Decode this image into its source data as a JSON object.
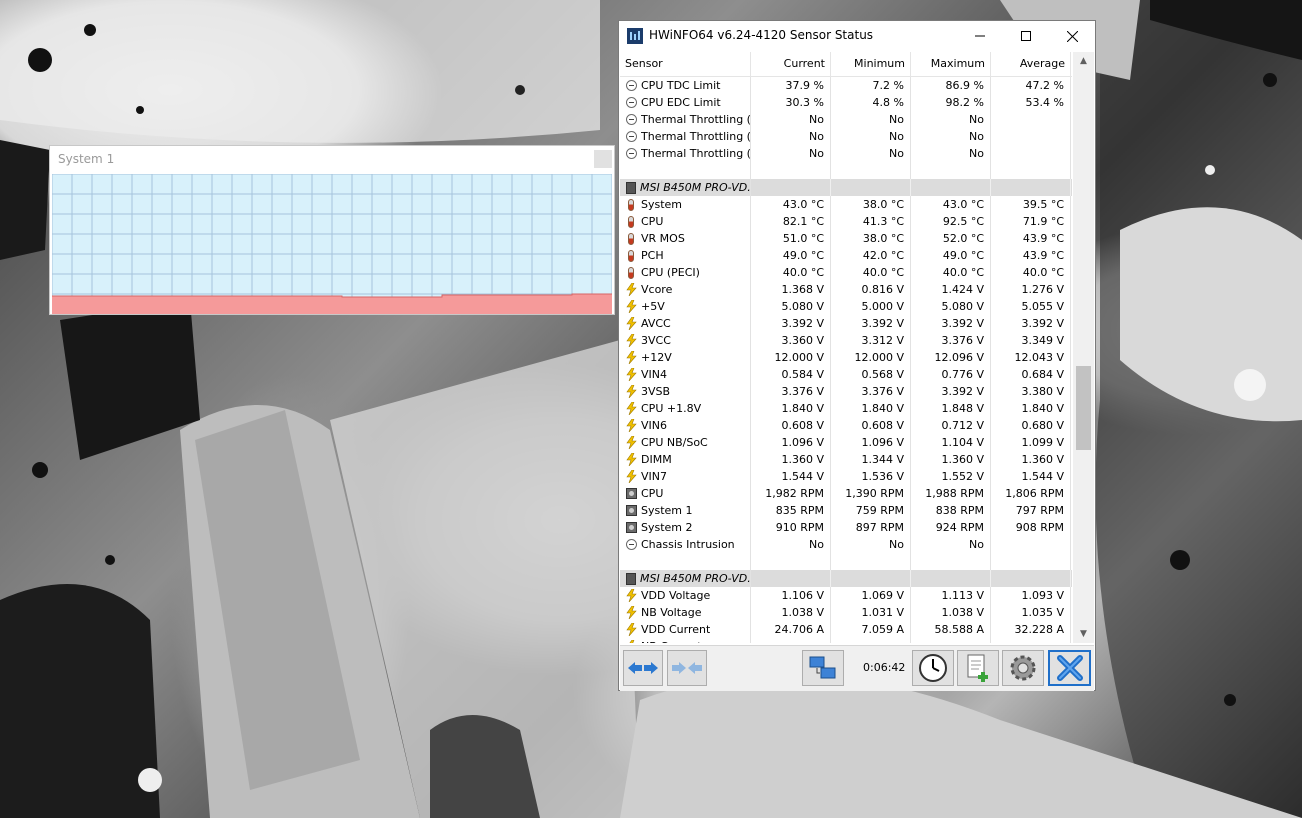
{
  "system_widget": {
    "title": "System 1"
  },
  "window": {
    "title": "HWiNFO64 v6.24-4120 Sensor Status",
    "columns": [
      "Sensor",
      "Current",
      "Minimum",
      "Maximum",
      "Average"
    ],
    "rows": [
      {
        "icon": "minus",
        "label": "CPU TDC Limit",
        "cur": "37.9 %",
        "min": "7.2 %",
        "max": "86.9 %",
        "avg": "47.2 %"
      },
      {
        "icon": "minus",
        "label": "CPU EDC Limit",
        "cur": "30.3 %",
        "min": "4.8 %",
        "max": "98.2 %",
        "avg": "53.4 %"
      },
      {
        "icon": "minus",
        "label": "Thermal Throttling (...",
        "cur": "No",
        "min": "No",
        "max": "No",
        "avg": ""
      },
      {
        "icon": "minus",
        "label": "Thermal Throttling (...",
        "cur": "No",
        "min": "No",
        "max": "No",
        "avg": ""
      },
      {
        "icon": "minus",
        "label": "Thermal Throttling (...",
        "cur": "No",
        "min": "No",
        "max": "No",
        "avg": ""
      },
      {
        "icon": "blank",
        "label": "",
        "cur": "",
        "min": "",
        "max": "",
        "avg": ""
      },
      {
        "icon": "chip",
        "label": "MSI B450M PRO-VD...",
        "cur": "",
        "min": "",
        "max": "",
        "avg": "",
        "group": true
      },
      {
        "icon": "therm",
        "label": "System",
        "cur": "43.0 °C",
        "min": "38.0 °C",
        "max": "43.0 °C",
        "avg": "39.5 °C"
      },
      {
        "icon": "therm",
        "label": "CPU",
        "cur": "82.1 °C",
        "min": "41.3 °C",
        "max": "92.5 °C",
        "avg": "71.9 °C"
      },
      {
        "icon": "therm",
        "label": "VR MOS",
        "cur": "51.0 °C",
        "min": "38.0 °C",
        "max": "52.0 °C",
        "avg": "43.9 °C"
      },
      {
        "icon": "therm",
        "label": "PCH",
        "cur": "49.0 °C",
        "min": "42.0 °C",
        "max": "49.0 °C",
        "avg": "43.9 °C"
      },
      {
        "icon": "therm",
        "label": "CPU (PECI)",
        "cur": "40.0 °C",
        "min": "40.0 °C",
        "max": "40.0 °C",
        "avg": "40.0 °C"
      },
      {
        "icon": "bolt",
        "label": "Vcore",
        "cur": "1.368 V",
        "min": "0.816 V",
        "max": "1.424 V",
        "avg": "1.276 V"
      },
      {
        "icon": "bolt",
        "label": "+5V",
        "cur": "5.080 V",
        "min": "5.000 V",
        "max": "5.080 V",
        "avg": "5.055 V"
      },
      {
        "icon": "bolt",
        "label": "AVCC",
        "cur": "3.392 V",
        "min": "3.392 V",
        "max": "3.392 V",
        "avg": "3.392 V"
      },
      {
        "icon": "bolt",
        "label": "3VCC",
        "cur": "3.360 V",
        "min": "3.312 V",
        "max": "3.376 V",
        "avg": "3.349 V"
      },
      {
        "icon": "bolt",
        "label": "+12V",
        "cur": "12.000 V",
        "min": "12.000 V",
        "max": "12.096 V",
        "avg": "12.043 V"
      },
      {
        "icon": "bolt",
        "label": "VIN4",
        "cur": "0.584 V",
        "min": "0.568 V",
        "max": "0.776 V",
        "avg": "0.684 V"
      },
      {
        "icon": "bolt",
        "label": "3VSB",
        "cur": "3.376 V",
        "min": "3.376 V",
        "max": "3.392 V",
        "avg": "3.380 V"
      },
      {
        "icon": "bolt",
        "label": "CPU +1.8V",
        "cur": "1.840 V",
        "min": "1.840 V",
        "max": "1.848 V",
        "avg": "1.840 V"
      },
      {
        "icon": "bolt",
        "label": "VIN6",
        "cur": "0.608 V",
        "min": "0.608 V",
        "max": "0.712 V",
        "avg": "0.680 V"
      },
      {
        "icon": "bolt",
        "label": "CPU NB/SoC",
        "cur": "1.096 V",
        "min": "1.096 V",
        "max": "1.104 V",
        "avg": "1.099 V"
      },
      {
        "icon": "bolt",
        "label": "DIMM",
        "cur": "1.360 V",
        "min": "1.344 V",
        "max": "1.360 V",
        "avg": "1.360 V"
      },
      {
        "icon": "bolt",
        "label": "VIN7",
        "cur": "1.544 V",
        "min": "1.536 V",
        "max": "1.552 V",
        "avg": "1.544 V"
      },
      {
        "icon": "fan",
        "label": "CPU",
        "cur": "1,982 RPM",
        "min": "1,390 RPM",
        "max": "1,988 RPM",
        "avg": "1,806 RPM"
      },
      {
        "icon": "fan",
        "label": "System 1",
        "cur": "835 RPM",
        "min": "759 RPM",
        "max": "838 RPM",
        "avg": "797 RPM"
      },
      {
        "icon": "fan",
        "label": "System 2",
        "cur": "910 RPM",
        "min": "897 RPM",
        "max": "924 RPM",
        "avg": "908 RPM"
      },
      {
        "icon": "minus",
        "label": "Chassis Intrusion",
        "cur": "No",
        "min": "No",
        "max": "No",
        "avg": ""
      },
      {
        "icon": "blank",
        "label": "",
        "cur": "",
        "min": "",
        "max": "",
        "avg": ""
      },
      {
        "icon": "chip",
        "label": "MSI B450M PRO-VD...",
        "cur": "",
        "min": "",
        "max": "",
        "avg": "",
        "group": true
      },
      {
        "icon": "bolt",
        "label": "VDD Voltage",
        "cur": "1.106 V",
        "min": "1.069 V",
        "max": "1.113 V",
        "avg": "1.093 V"
      },
      {
        "icon": "bolt",
        "label": "NB Voltage",
        "cur": "1.038 V",
        "min": "1.031 V",
        "max": "1.038 V",
        "avg": "1.035 V"
      },
      {
        "icon": "bolt",
        "label": "VDD Current",
        "cur": "24.706 A",
        "min": "7.059 A",
        "max": "58.588 A",
        "avg": "32.228 A"
      },
      {
        "icon": "bolt",
        "label": "NB Current",
        "cur": "",
        "min": "",
        "max": "",
        "avg": ""
      }
    ]
  },
  "toolbar": {
    "timer": "0:06:42"
  },
  "colors": {
    "graph_bg": "#d8f1fb",
    "graph_fill": "#f59a9a",
    "grid": "#a6c4dc",
    "close_blue": "#1f6fc9"
  }
}
